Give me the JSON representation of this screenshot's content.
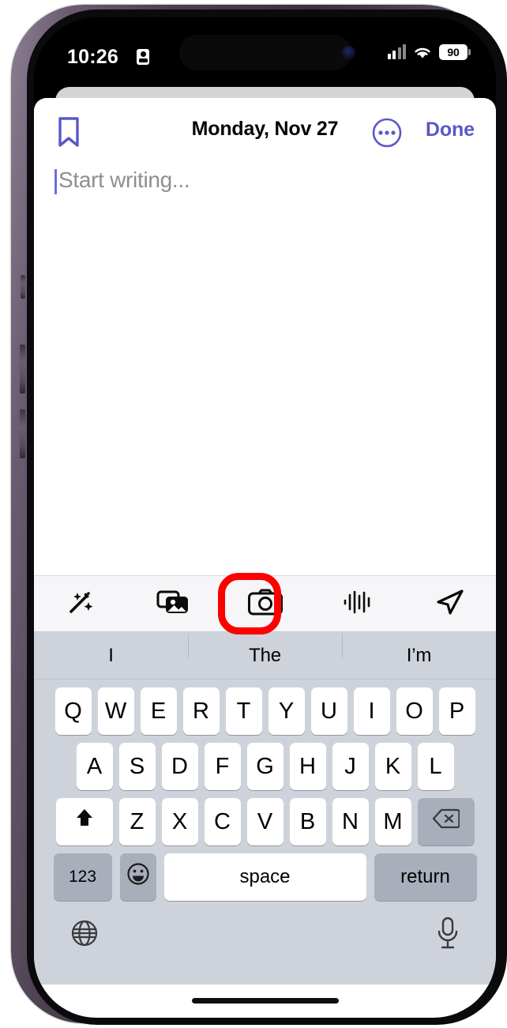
{
  "device": {
    "frame_color": "#5b4e61",
    "screen_bg": "#000000"
  },
  "status_bar": {
    "time": "10:26",
    "recording_icon": "id-card-icon",
    "signal_icon": "cellular-signal-icon",
    "wifi_icon": "wifi-icon",
    "battery_level": "90",
    "dynamic_island": "dynamic-island"
  },
  "note_sheet": {
    "header": {
      "bookmark_icon": "bookmark-icon",
      "title": "Monday, Nov 27",
      "more_icon": "ellipsis-circle-icon",
      "done_label": "Done"
    },
    "body": {
      "placeholder": "Start writing...",
      "value": ""
    }
  },
  "toolbar": {
    "items": [
      {
        "name": "magic-wand-icon",
        "label": "Magic Wand"
      },
      {
        "name": "photos-icon",
        "label": "Photos"
      },
      {
        "name": "camera-icon",
        "label": "Camera"
      },
      {
        "name": "audio-waveform-icon",
        "label": "Audio"
      },
      {
        "name": "location-arrow-icon",
        "label": "Location"
      }
    ],
    "highlight": {
      "target": "camera-icon",
      "shape": "rounded-rect",
      "color": "#fd0000"
    }
  },
  "keyboard": {
    "suggestions": [
      "I",
      "The",
      "I’m"
    ],
    "row1": [
      "Q",
      "W",
      "E",
      "R",
      "T",
      "Y",
      "U",
      "I",
      "O",
      "P"
    ],
    "row2": [
      "A",
      "S",
      "D",
      "F",
      "G",
      "H",
      "J",
      "K",
      "L"
    ],
    "row3": [
      "Z",
      "X",
      "C",
      "V",
      "B",
      "N",
      "M"
    ],
    "shift_icon": "shift-icon",
    "backspace_icon": "backspace-icon",
    "numbers_label": "123",
    "emoji_icon": "emoji-icon",
    "space_label": "space",
    "return_label": "return",
    "globe_icon": "globe-icon",
    "mic_icon": "microphone-icon"
  },
  "colors": {
    "accent": "#5a58c8",
    "keyboard_bg": "#ced2db",
    "key_bg": "#ffffff",
    "key_dark_bg": "#a9aebb",
    "toolbar_bg": "#f6f6f8",
    "placeholder_text": "#8e8e93",
    "annotation_red": "#fd0000"
  }
}
